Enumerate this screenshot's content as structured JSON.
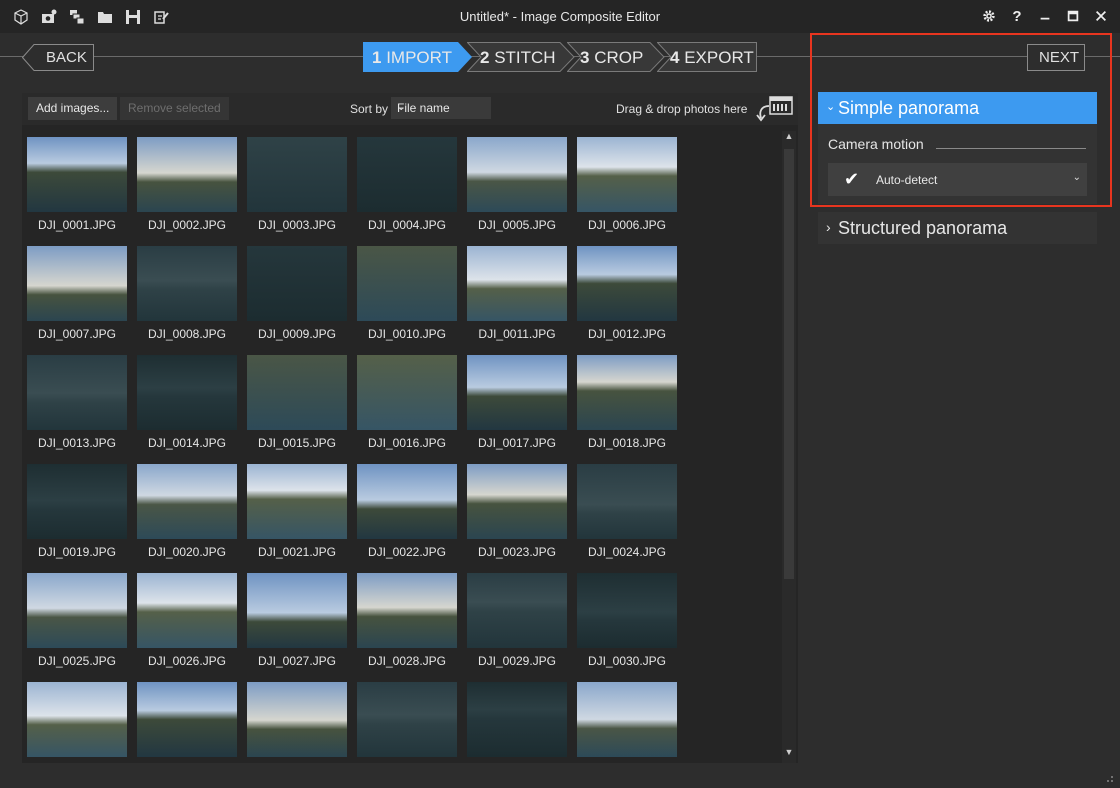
{
  "window": {
    "title": "Untitled* - Image Composite Editor",
    "toolbar_icons": [
      "new-panorama-icon",
      "new-from-video-icon",
      "new-from-images-icon",
      "open-project-icon",
      "save-icon",
      "export-icon"
    ],
    "controls": [
      "settings-icon",
      "help-icon",
      "minimize-icon",
      "maximize-icon",
      "close-icon"
    ],
    "help_label": "?"
  },
  "nav": {
    "back_label": "BACK",
    "next_label": "NEXT"
  },
  "steps": [
    {
      "num": "1",
      "label": "IMPORT",
      "active": true
    },
    {
      "num": "2",
      "label": "STITCH",
      "active": false
    },
    {
      "num": "3",
      "label": "CROP",
      "active": false
    },
    {
      "num": "4",
      "label": "EXPORT",
      "active": false
    }
  ],
  "import_toolbar": {
    "add_label": "Add images...",
    "remove_label": "Remove selected",
    "sort_label": "Sort by",
    "sort_value": "File name",
    "drop_text": "Drag & drop photos here"
  },
  "images": [
    "DJI_0001.JPG",
    "DJI_0002.JPG",
    "DJI_0003.JPG",
    "DJI_0004.JPG",
    "DJI_0005.JPG",
    "DJI_0006.JPG",
    "DJI_0007.JPG",
    "DJI_0008.JPG",
    "DJI_0009.JPG",
    "DJI_0010.JPG",
    "DJI_0011.JPG",
    "DJI_0012.JPG",
    "DJI_0013.JPG",
    "DJI_0014.JPG",
    "DJI_0015.JPG",
    "DJI_0016.JPG",
    "DJI_0017.JPG",
    "DJI_0018.JPG",
    "DJI_0019.JPG",
    "DJI_0020.JPG",
    "DJI_0021.JPG",
    "DJI_0022.JPG",
    "DJI_0023.JPG",
    "DJI_0024.JPG",
    "DJI_0025.JPG",
    "DJI_0026.JPG",
    "DJI_0027.JPG",
    "DJI_0028.JPG",
    "DJI_0029.JPG",
    "DJI_0030.JPG",
    "",
    "",
    "",
    "",
    "",
    ""
  ],
  "panorama": {
    "simple_label": "Simple panorama",
    "camera_motion_label": "Camera motion",
    "camera_motion_value": "Auto-detect",
    "structured_label": "Structured panorama"
  },
  "colors": {
    "accent": "#3d9af0",
    "highlight": "#e8351f"
  }
}
